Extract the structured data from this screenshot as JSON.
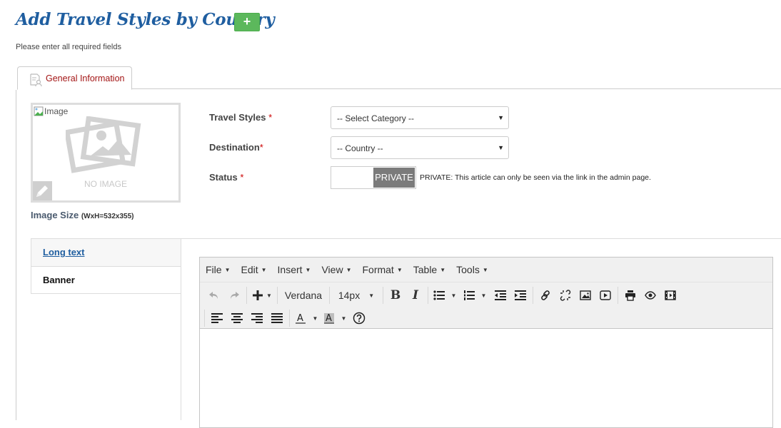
{
  "header": {
    "title": "Add Travel Styles by Country",
    "add_button_label": "+",
    "subtitle": "Please enter all required fields"
  },
  "tabs": [
    {
      "label": "General Information",
      "icon": "document-user-icon",
      "active": true
    }
  ],
  "image": {
    "alt_text": "Image",
    "placeholder_text": "NO IMAGE",
    "size_label": "Image Size",
    "size_value": "(WxH=532x355)"
  },
  "form": {
    "travel_styles": {
      "label": "Travel Styles",
      "required_mark": "*",
      "selected": "-- Select Category --"
    },
    "destination": {
      "label": "Destination",
      "required_mark": "*",
      "selected": "-- Country --"
    },
    "status": {
      "label": "Status",
      "required_mark": "*",
      "toggle_value": "PRIVATE",
      "note": "PRIVATE: This article can only be seen via the link in the admin page."
    }
  },
  "side_tabs": [
    {
      "label": "Long text",
      "active": true
    },
    {
      "label": "Banner",
      "active": false
    }
  ],
  "editor": {
    "menus": [
      "File",
      "Edit",
      "Insert",
      "View",
      "Format",
      "Table",
      "Tools"
    ],
    "font_family": "Verdana",
    "font_size": "14px",
    "content": ""
  }
}
